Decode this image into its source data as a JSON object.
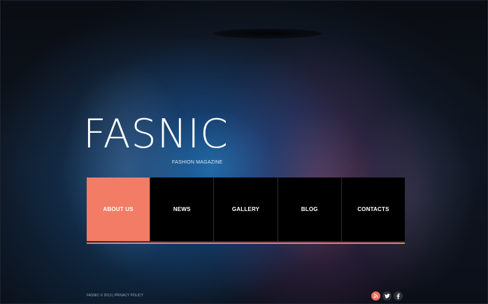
{
  "brand": {
    "title": "FASNIC",
    "tagline": "FASHION MAGAZINE"
  },
  "nav": {
    "items": [
      {
        "label": "ABOUT US",
        "active": true
      },
      {
        "label": "NEWS",
        "active": false
      },
      {
        "label": "GALLERY",
        "active": false
      },
      {
        "label": "BLOG",
        "active": false
      },
      {
        "label": "CONTACTS",
        "active": false
      }
    ]
  },
  "footer": {
    "copyright": "FASNIC © 2013 | PRIVACY POLICY"
  },
  "social": [
    {
      "icon": "rss-icon"
    },
    {
      "icon": "twitter-icon"
    },
    {
      "icon": "facebook-icon"
    }
  ],
  "colors": {
    "accent": "#f27c65",
    "nav_background": "#000000",
    "text": "#ffffff"
  }
}
